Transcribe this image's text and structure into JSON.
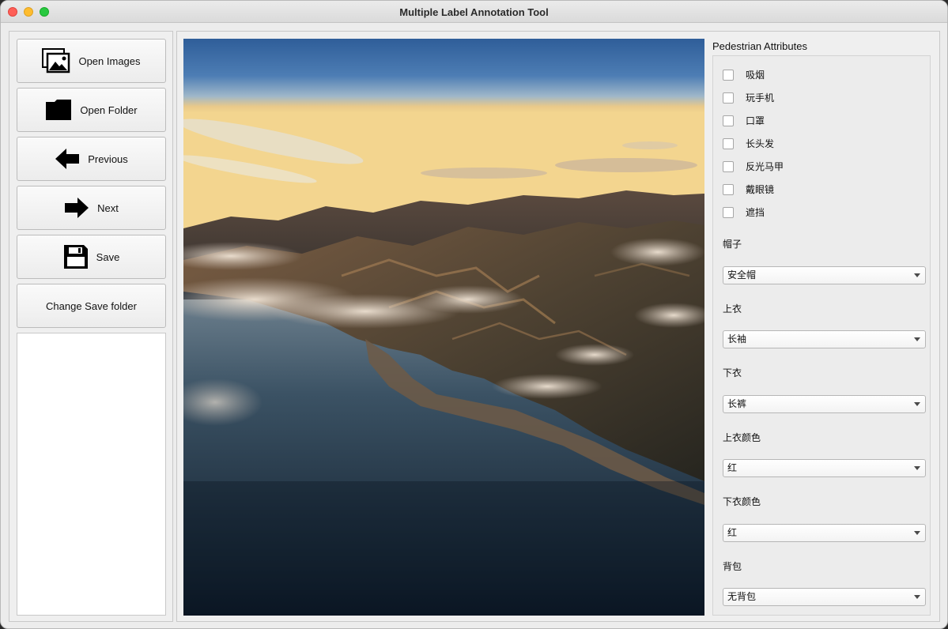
{
  "window": {
    "title": "Multiple Label Annotation Tool"
  },
  "toolbar": {
    "open_images": {
      "label": "Open Images",
      "icon": "images-icon"
    },
    "open_folder": {
      "label": "Open Folder",
      "icon": "folder-icon"
    },
    "previous": {
      "label": "Previous",
      "icon": "arrow-left-icon"
    },
    "next": {
      "label": "Next",
      "icon": "arrow-right-icon"
    },
    "save": {
      "label": "Save",
      "icon": "floppy-disk-icon"
    },
    "change_save_folder": {
      "label": "Change Save folder"
    }
  },
  "image": {
    "subject": "aerial coastal mountain landscape at sunrise"
  },
  "attributes": {
    "title": "Pedestrian Attributes",
    "checkboxes": [
      {
        "label": "吸烟",
        "checked": false
      },
      {
        "label": "玩手机",
        "checked": false
      },
      {
        "label": "口罩",
        "checked": false
      },
      {
        "label": "长头发",
        "checked": false
      },
      {
        "label": "反光马甲",
        "checked": false
      },
      {
        "label": "戴眼镜",
        "checked": false
      },
      {
        "label": "遮挡",
        "checked": false
      }
    ],
    "dropdowns": [
      {
        "label": "帽子",
        "value": "安全帽"
      },
      {
        "label": "上衣",
        "value": "长袖"
      },
      {
        "label": "下衣",
        "value": "长裤"
      },
      {
        "label": "上衣颜色",
        "value": "红"
      },
      {
        "label": "下衣颜色",
        "value": "红"
      },
      {
        "label": "背包",
        "value": "无背包"
      }
    ]
  },
  "colors": {
    "close": "#fe5f57",
    "minimize": "#febc2e",
    "zoom": "#28c840"
  }
}
